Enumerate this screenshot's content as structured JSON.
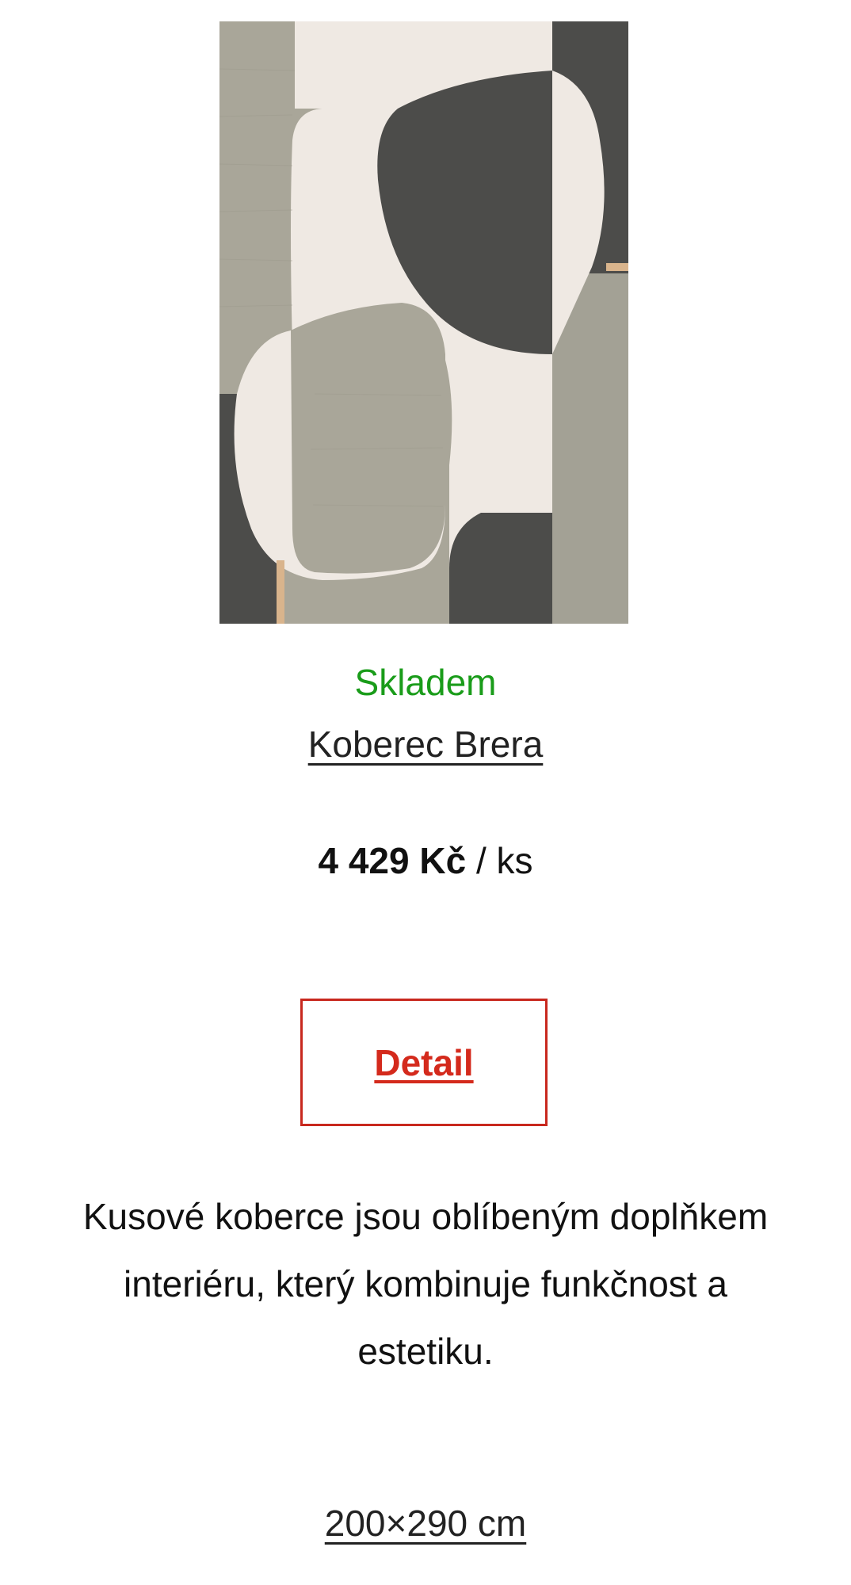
{
  "product": {
    "image_alt": "Koberec Brera",
    "stock_status": "Skladem",
    "name": "Koberec Brera",
    "price": "4 429 Kč",
    "price_unit": "/ ks",
    "detail_button_label": "Detail",
    "description": "Kusové koberce jsou oblíbeným doplňkem interiéru, který kombinuje funkčnost a estetiku.",
    "size": "200×290 cm"
  },
  "colors": {
    "stock_green": "#1a9c1a",
    "accent_red": "#d42a1c",
    "rug_light_gray": "#a9a699",
    "rug_dark_gray": "#4c4c4a",
    "rug_cream": "#efe9e3",
    "rug_tan": "#d9b48c"
  }
}
